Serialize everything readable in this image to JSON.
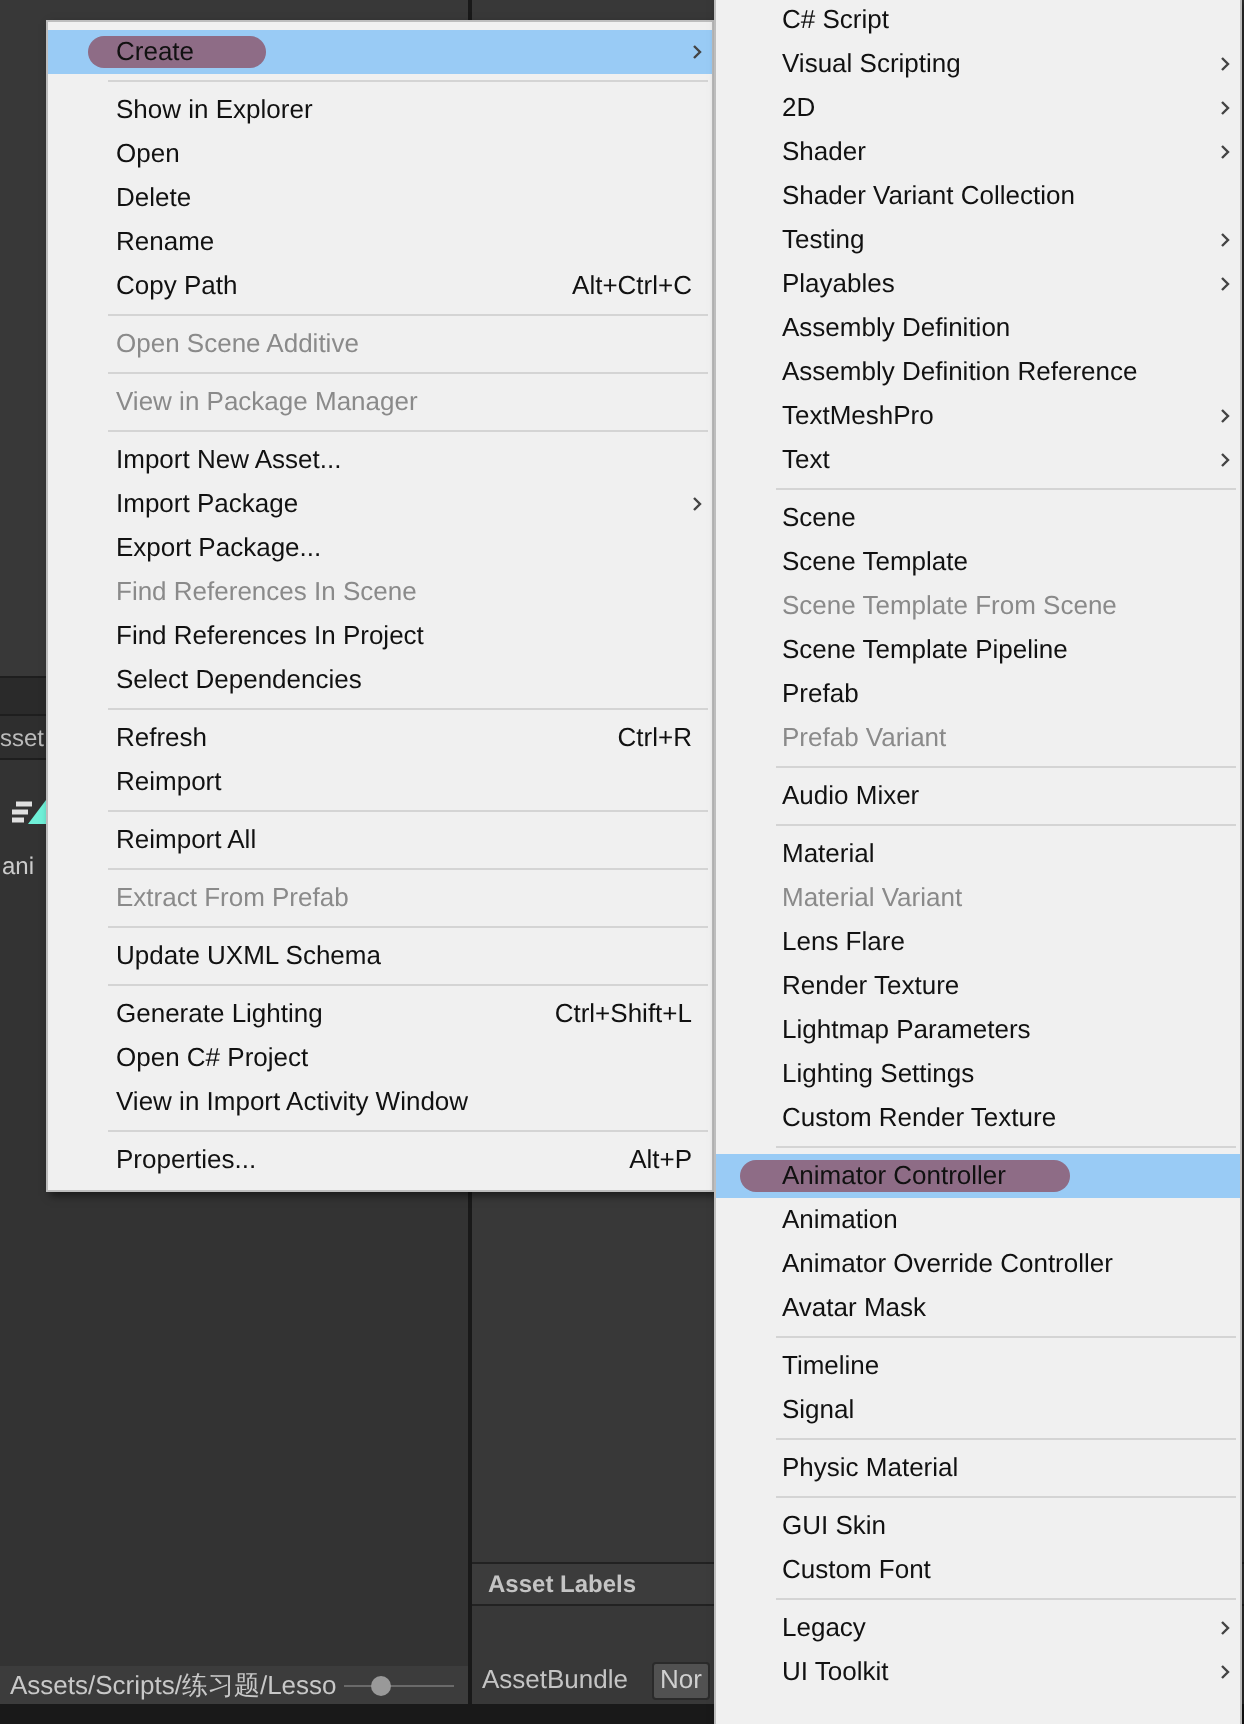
{
  "background": {
    "asset_tab": "sset",
    "asset_name": "ani",
    "zoom_slider": {
      "level": 0.3
    },
    "path": "Assets/Scripts/练习题/Lesso",
    "inspector_header": "Asset Labels",
    "asset_bundle_label": "AssetBundle",
    "asset_bundle_value": "Nor"
  },
  "context_menu": {
    "groups": [
      [
        {
          "label": "Create",
          "submenu": true,
          "selected": true,
          "disabled": false
        }
      ],
      [
        {
          "label": "Show in Explorer",
          "submenu": false,
          "selected": false,
          "disabled": false
        },
        {
          "label": "Open",
          "submenu": false,
          "selected": false,
          "disabled": false
        },
        {
          "label": "Delete",
          "submenu": false,
          "selected": false,
          "disabled": false
        },
        {
          "label": "Rename",
          "submenu": false,
          "selected": false,
          "disabled": false
        },
        {
          "label": "Copy Path",
          "shortcut": "Alt+Ctrl+C",
          "submenu": false,
          "selected": false,
          "disabled": false
        }
      ],
      [
        {
          "label": "Open Scene Additive",
          "submenu": false,
          "selected": false,
          "disabled": true
        }
      ],
      [
        {
          "label": "View in Package Manager",
          "submenu": false,
          "selected": false,
          "disabled": true
        }
      ],
      [
        {
          "label": "Import New Asset...",
          "submenu": false,
          "selected": false,
          "disabled": false
        },
        {
          "label": "Import Package",
          "submenu": true,
          "selected": false,
          "disabled": false
        },
        {
          "label": "Export Package...",
          "submenu": false,
          "selected": false,
          "disabled": false
        },
        {
          "label": "Find References In Scene",
          "submenu": false,
          "selected": false,
          "disabled": true
        },
        {
          "label": "Find References In Project",
          "submenu": false,
          "selected": false,
          "disabled": false
        },
        {
          "label": "Select Dependencies",
          "submenu": false,
          "selected": false,
          "disabled": false
        }
      ],
      [
        {
          "label": "Refresh",
          "shortcut": "Ctrl+R",
          "submenu": false,
          "selected": false,
          "disabled": false
        },
        {
          "label": "Reimport",
          "submenu": false,
          "selected": false,
          "disabled": false
        }
      ],
      [
        {
          "label": "Reimport All",
          "submenu": false,
          "selected": false,
          "disabled": false
        }
      ],
      [
        {
          "label": "Extract From Prefab",
          "submenu": false,
          "selected": false,
          "disabled": true
        }
      ],
      [
        {
          "label": "Update UXML Schema",
          "submenu": false,
          "selected": false,
          "disabled": false
        }
      ],
      [
        {
          "label": "Generate Lighting",
          "shortcut": "Ctrl+Shift+L",
          "submenu": false,
          "selected": false,
          "disabled": false
        },
        {
          "label": "Open C# Project",
          "submenu": false,
          "selected": false,
          "disabled": false
        },
        {
          "label": "View in Import Activity Window",
          "submenu": false,
          "selected": false,
          "disabled": false
        }
      ],
      [
        {
          "label": "Properties...",
          "shortcut": "Alt+P",
          "submenu": false,
          "selected": false,
          "disabled": false
        }
      ]
    ]
  },
  "create_submenu": {
    "groups": [
      [
        {
          "label": "C# Script",
          "submenu": false,
          "selected": false,
          "disabled": false
        },
        {
          "label": "Visual Scripting",
          "submenu": true,
          "selected": false,
          "disabled": false
        },
        {
          "label": "2D",
          "submenu": true,
          "selected": false,
          "disabled": false
        },
        {
          "label": "Shader",
          "submenu": true,
          "selected": false,
          "disabled": false
        },
        {
          "label": "Shader Variant Collection",
          "submenu": false,
          "selected": false,
          "disabled": false
        },
        {
          "label": "Testing",
          "submenu": true,
          "selected": false,
          "disabled": false
        },
        {
          "label": "Playables",
          "submenu": true,
          "selected": false,
          "disabled": false
        },
        {
          "label": "Assembly Definition",
          "submenu": false,
          "selected": false,
          "disabled": false
        },
        {
          "label": "Assembly Definition Reference",
          "submenu": false,
          "selected": false,
          "disabled": false
        },
        {
          "label": "TextMeshPro",
          "submenu": true,
          "selected": false,
          "disabled": false
        },
        {
          "label": "Text",
          "submenu": true,
          "selected": false,
          "disabled": false
        }
      ],
      [
        {
          "label": "Scene",
          "submenu": false,
          "selected": false,
          "disabled": false
        },
        {
          "label": "Scene Template",
          "submenu": false,
          "selected": false,
          "disabled": false
        },
        {
          "label": "Scene Template From Scene",
          "submenu": false,
          "selected": false,
          "disabled": true
        },
        {
          "label": "Scene Template Pipeline",
          "submenu": false,
          "selected": false,
          "disabled": false
        },
        {
          "label": "Prefab",
          "submenu": false,
          "selected": false,
          "disabled": false
        },
        {
          "label": "Prefab Variant",
          "submenu": false,
          "selected": false,
          "disabled": true
        }
      ],
      [
        {
          "label": "Audio Mixer",
          "submenu": false,
          "selected": false,
          "disabled": false
        }
      ],
      [
        {
          "label": "Material",
          "submenu": false,
          "selected": false,
          "disabled": false
        },
        {
          "label": "Material Variant",
          "submenu": false,
          "selected": false,
          "disabled": true
        },
        {
          "label": "Lens Flare",
          "submenu": false,
          "selected": false,
          "disabled": false
        },
        {
          "label": "Render Texture",
          "submenu": false,
          "selected": false,
          "disabled": false
        },
        {
          "label": "Lightmap Parameters",
          "submenu": false,
          "selected": false,
          "disabled": false
        },
        {
          "label": "Lighting Settings",
          "submenu": false,
          "selected": false,
          "disabled": false
        },
        {
          "label": "Custom Render Texture",
          "submenu": false,
          "selected": false,
          "disabled": false
        }
      ],
      [
        {
          "label": "Animator Controller",
          "submenu": false,
          "selected": true,
          "disabled": false
        },
        {
          "label": "Animation",
          "submenu": false,
          "selected": false,
          "disabled": false
        },
        {
          "label": "Animator Override Controller",
          "submenu": false,
          "selected": false,
          "disabled": false
        },
        {
          "label": "Avatar Mask",
          "submenu": false,
          "selected": false,
          "disabled": false
        }
      ],
      [
        {
          "label": "Timeline",
          "submenu": false,
          "selected": false,
          "disabled": false
        },
        {
          "label": "Signal",
          "submenu": false,
          "selected": false,
          "disabled": false
        }
      ],
      [
        {
          "label": "Physic Material",
          "submenu": false,
          "selected": false,
          "disabled": false
        }
      ],
      [
        {
          "label": "GUI Skin",
          "submenu": false,
          "selected": false,
          "disabled": false
        },
        {
          "label": "Custom Font",
          "submenu": false,
          "selected": false,
          "disabled": false
        }
      ],
      [
        {
          "label": "Legacy",
          "submenu": true,
          "selected": false,
          "disabled": false
        },
        {
          "label": "UI Toolkit",
          "submenu": true,
          "selected": false,
          "disabled": false
        }
      ]
    ]
  }
}
